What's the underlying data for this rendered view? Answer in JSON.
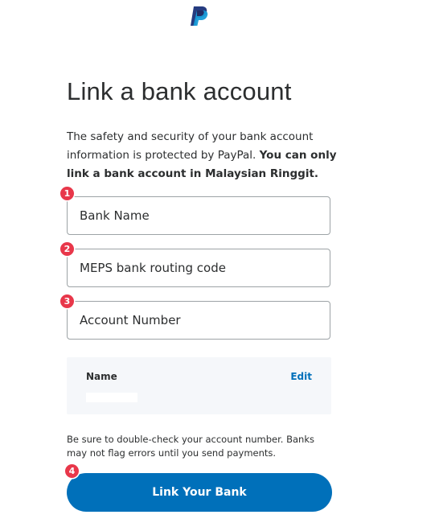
{
  "brand": {
    "logo_icon": "paypal-logo-icon",
    "colors": {
      "primary": "#0070ba",
      "badge": "#e8374a"
    }
  },
  "page": {
    "title": "Link a bank account",
    "description_text": "The safety and security of your bank account information is protected by PayPal.",
    "description_bold": "You can only link a bank account in Malaysian Ringgit."
  },
  "form": {
    "bank_name_placeholder": "Bank Name",
    "routing_code_placeholder": "MEPS bank routing code",
    "account_number_placeholder": "Account Number"
  },
  "name_section": {
    "label": "Name",
    "edit_label": "Edit",
    "value": ""
  },
  "note": "Be sure to double-check your account number. Banks may not flag errors until you send payments.",
  "submit_label": "Link Your Bank",
  "badges": [
    "1",
    "2",
    "3",
    "4"
  ]
}
